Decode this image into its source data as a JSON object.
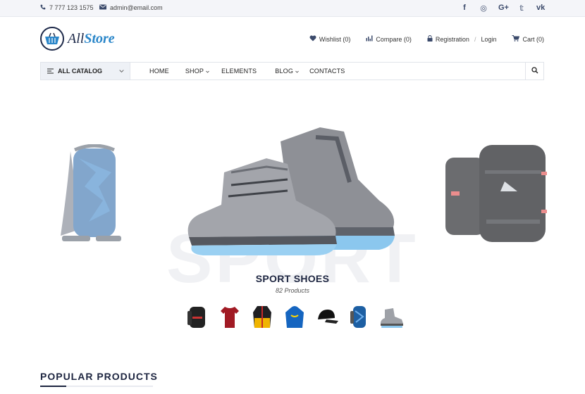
{
  "topbar": {
    "phone": "7 777 123 1575",
    "email": "admin@email.com",
    "social": [
      {
        "icon": "facebook-icon",
        "glyph": "f"
      },
      {
        "icon": "instagram-icon",
        "glyph": "◎"
      },
      {
        "icon": "google-plus-icon",
        "glyph": "G+"
      },
      {
        "icon": "twitter-icon",
        "glyph": "𝕥"
      },
      {
        "icon": "vk-icon",
        "glyph": "vk"
      }
    ]
  },
  "header": {
    "logo_prefix": "All",
    "logo_suffix": "Store",
    "wishlist": "Wishlist (0)",
    "compare": "Compare (0)",
    "registration": "Registration",
    "login": "Login",
    "cart": "Cart (0)"
  },
  "nav": {
    "catalog": "ALL CATALOG",
    "items": [
      "HOME",
      "SHOP",
      "ELEMENTS",
      "BLOG",
      "CONTACTS"
    ]
  },
  "hero": {
    "watermark": "SPORT",
    "title": "SPORT SHOES",
    "count": "82 Products"
  },
  "section": {
    "popular": "POPULAR PRODUCTS"
  },
  "colors": {
    "brand_dark": "#1e2a4a",
    "brand_blue": "#2a86c9"
  }
}
